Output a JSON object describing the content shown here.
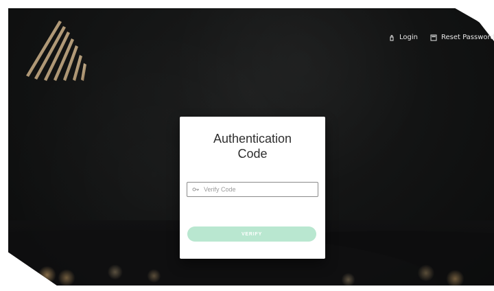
{
  "topnav": {
    "login_label": "Login",
    "reset_label": "Reset Password"
  },
  "auth_card": {
    "title_line1": "Authentication",
    "title_line2": "Code",
    "input_placeholder": "Verify Code",
    "verify_label": "VERIFY"
  },
  "colors": {
    "card_bg": "#ffffff",
    "verify_button_bg": "#b9e7d0",
    "input_border": "#8a8a8a",
    "page_bg_dark": "#121313",
    "logo_gold": "#c9b18b"
  },
  "icons": {
    "logo": "gold-stripes-logo",
    "login": "login-icon",
    "reset": "reset-password-icon",
    "input": "key-icon"
  }
}
